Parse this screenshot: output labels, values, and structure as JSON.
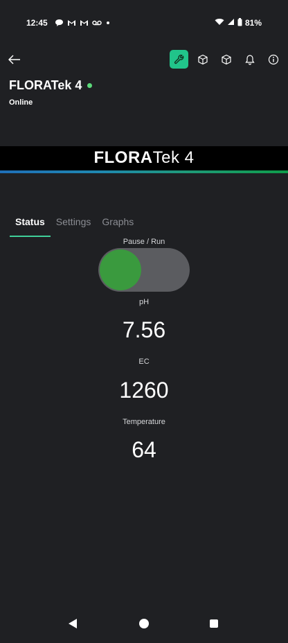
{
  "status_bar": {
    "time": "12:45",
    "notification_icons": [
      "chat-bubble-icon",
      "gmail-icon",
      "gmail-icon",
      "voicemail-icon",
      "dot-icon"
    ],
    "battery": "81%"
  },
  "header": {
    "actions": [
      "wrench-icon",
      "cube-icon",
      "cube-icon",
      "bell-icon",
      "info-icon"
    ],
    "accent_color": "#21c48a"
  },
  "device": {
    "name": "FLORATek 4",
    "status": "Online",
    "status_color": "#5cd97a"
  },
  "banner": {
    "brand_bold": "FLORA",
    "brand_rest": "Tek 4"
  },
  "tabs": [
    {
      "label": "Status",
      "active": true
    },
    {
      "label": "Settings",
      "active": false
    },
    {
      "label": "Graphs",
      "active": false
    }
  ],
  "toggle": {
    "label": "Pause / Run",
    "state": "off"
  },
  "readings": [
    {
      "label": "pH",
      "value": "7.56"
    },
    {
      "label": "EC",
      "value": "1260"
    },
    {
      "label": "Temperature",
      "value": "64"
    }
  ]
}
